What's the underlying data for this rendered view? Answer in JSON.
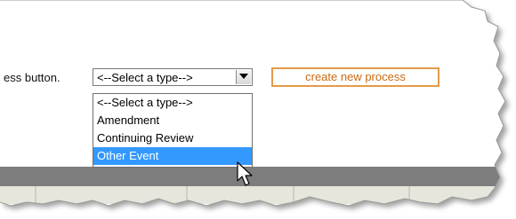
{
  "colors": {
    "page_bg": "#ffffff",
    "dark_band": "#7d7d7d",
    "highlight": "#3399ff",
    "button_text": "#c96a12",
    "button_border": "#e39b4a"
  },
  "form": {
    "label": "ess button."
  },
  "type_select": {
    "value": "<--Select a type-->",
    "options": [
      {
        "label": "<--Select a type-->",
        "selected": false
      },
      {
        "label": "Amendment",
        "selected": false
      },
      {
        "label": "Continuing Review",
        "selected": false
      },
      {
        "label": "Other Event",
        "selected": true
      }
    ]
  },
  "create_button": {
    "label": "create new process"
  },
  "icons": {
    "select_arrow": "chevron-down-icon",
    "cursor": "mouse-pointer-icon"
  }
}
